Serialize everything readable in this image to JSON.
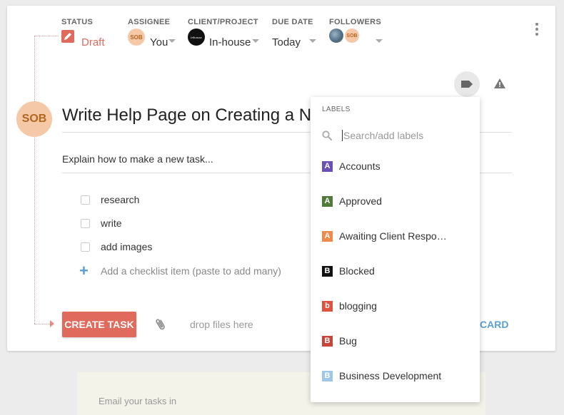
{
  "header": {
    "status": {
      "label": "STATUS",
      "value": "Draft",
      "color": "#e06a5b"
    },
    "assignee": {
      "label": "ASSIGNEE",
      "avatar": "SOB",
      "value": "You"
    },
    "client": {
      "label": "CLIENT/PROJECT",
      "value": "In-house"
    },
    "due": {
      "label": "DUE DATE",
      "value": "Today"
    },
    "followers": {
      "label": "FOLLOWERS",
      "avatar": "SOB"
    }
  },
  "task": {
    "avatar": "SOB",
    "title": "Write Help Page on Creating a New Task",
    "description": "Explain how to make a new task...",
    "checklist": [
      {
        "label": "research",
        "checked": false
      },
      {
        "label": "write",
        "checked": false
      },
      {
        "label": "add images",
        "checked": false
      }
    ],
    "add_checklist_label": "Add a checklist item (paste to add many)"
  },
  "footer": {
    "create_label": "CREATE TASK",
    "drop_label": "drop files here",
    "discard_label": "CARD"
  },
  "labels_dropdown": {
    "header": "LABELS",
    "search_placeholder": "Search/add labels",
    "items": [
      {
        "letter": "A",
        "name": "Accounts",
        "color": "#6a4fb5"
      },
      {
        "letter": "A",
        "name": "Approved",
        "color": "#4f7a3a"
      },
      {
        "letter": "A",
        "name": "Awaiting Client Respo…",
        "color": "#f08a4b"
      },
      {
        "letter": "B",
        "name": "Blocked",
        "color": "#111111"
      },
      {
        "letter": "b",
        "name": "blogging",
        "color": "#e0523e"
      },
      {
        "letter": "B",
        "name": "Bug",
        "color": "#c9453a"
      },
      {
        "letter": "B",
        "name": "Business Development",
        "color": "#9ec8e8"
      }
    ]
  },
  "email_panel": {
    "text": "Email your tasks in"
  },
  "icons": {
    "status": "pencil-icon",
    "label": "tag-icon",
    "warning": "warning-icon",
    "more": "kebab-icon",
    "attach": "paperclip-icon",
    "search": "search-icon"
  }
}
